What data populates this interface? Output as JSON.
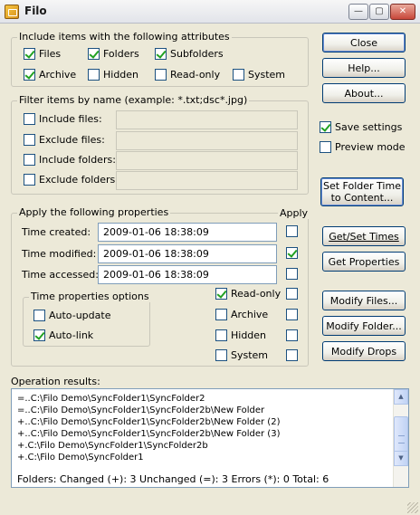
{
  "window": {
    "title": "Filo"
  },
  "attributes_group": {
    "legend": "Include items with the following attributes",
    "items": [
      {
        "label": "Files",
        "checked": true
      },
      {
        "label": "Folders",
        "checked": true
      },
      {
        "label": "Subfolders",
        "checked": true
      },
      {
        "label": "Archive",
        "checked": true
      },
      {
        "label": "Hidden",
        "checked": false
      },
      {
        "label": "Read-only",
        "checked": false
      },
      {
        "label": "System",
        "checked": false
      }
    ]
  },
  "filter_group": {
    "legend": "Filter items by name (example: *.txt;dsc*.jpg)",
    "items": [
      {
        "label": "Include files:",
        "checked": false,
        "value": ""
      },
      {
        "label": "Exclude files:",
        "checked": false,
        "value": ""
      },
      {
        "label": "Include folders:",
        "checked": false,
        "value": ""
      },
      {
        "label": "Exclude folders:",
        "checked": false,
        "value": ""
      }
    ]
  },
  "properties_group": {
    "legend": "Apply the following properties",
    "apply_header": "Apply",
    "times": [
      {
        "label": "Time created:",
        "value": "2009-01-06 18:38:09",
        "apply": false
      },
      {
        "label": "Time modified:",
        "value": "2009-01-06 18:38:09",
        "apply": true
      },
      {
        "label": "Time accessed:",
        "value": "2009-01-06 18:38:09",
        "apply": false
      }
    ],
    "time_options": {
      "legend": "Time properties options",
      "items": [
        {
          "label": "Auto-update",
          "checked": false
        },
        {
          "label": "Auto-link",
          "checked": true
        }
      ]
    },
    "attributes": [
      {
        "label": "Read-only",
        "checked": true,
        "apply": false
      },
      {
        "label": "Archive",
        "checked": false,
        "apply": false
      },
      {
        "label": "Hidden",
        "checked": false,
        "apply": false
      },
      {
        "label": "System",
        "checked": false,
        "apply": false
      }
    ]
  },
  "buttons": {
    "close": "Close",
    "help": "Help...",
    "about": "About...",
    "set_folder_time_line1": "Set Folder Time",
    "set_folder_time_line2": "to Content...",
    "get_set_times": "Get/Set Times",
    "get_properties": "Get Properties",
    "modify_files": "Modify Files...",
    "modify_folder": "Modify Folder...",
    "modify_drops": "Modify Drops"
  },
  "options": {
    "save_settings": {
      "label": "Save settings",
      "checked": true
    },
    "preview_mode": {
      "label": "Preview mode",
      "checked": false
    }
  },
  "results": {
    "label": "Operation results:",
    "lines": [
      "=..C:\\Filo Demo\\SyncFolder1\\SyncFolder2",
      "=..C:\\Filo Demo\\SyncFolder1\\SyncFolder2b\\New Folder",
      "+..C:\\Filo Demo\\SyncFolder1\\SyncFolder2b\\New Folder (2)",
      "+..C:\\Filo Demo\\SyncFolder1\\SyncFolder2b\\New Folder (3)",
      "+.C:\\Filo Demo\\SyncFolder1\\SyncFolder2b",
      "+.C:\\Filo Demo\\SyncFolder1"
    ],
    "summary": "Folders:   Changed (+): 3     Unchanged (=): 3     Errors (*): 0     Total: 6"
  }
}
